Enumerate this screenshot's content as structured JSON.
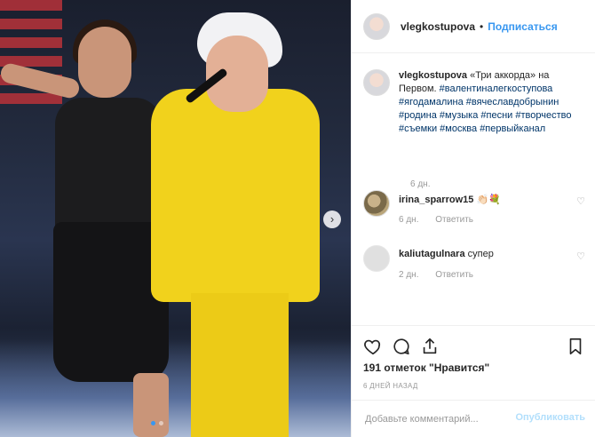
{
  "post": {
    "username": "vlegkostupova",
    "separator": "•",
    "follow_label": "Подписаться",
    "caption_text": "«Три аккорда» на Первом.",
    "caption_hashtags": "#валентиналегкоступова #ягодамалина #вячеславдобрынин #родина #музыка #песни #творчество #съемки #москва #первыйканал",
    "caption_time": "6 дн."
  },
  "comments": [
    {
      "username": "irina_sparrow15",
      "text": "👏🏻💐",
      "time": "6 дн.",
      "reply_label": "Ответить"
    },
    {
      "username": "kaliutagulnara",
      "text": "супер",
      "time": "2 дн.",
      "reply_label": "Ответить"
    }
  ],
  "actions": {
    "likes": "191 отметок \"Нравится\"",
    "posted": "6 дней назад"
  },
  "add_comment": {
    "placeholder": "Добавьте комментарий...",
    "publish_label": "Опубликовать"
  },
  "carousel": {
    "next_symbol": "›"
  },
  "colors": {
    "accent": "#3897f0",
    "suit_yellow": "#f1d21c",
    "hashtag": "#003569"
  }
}
